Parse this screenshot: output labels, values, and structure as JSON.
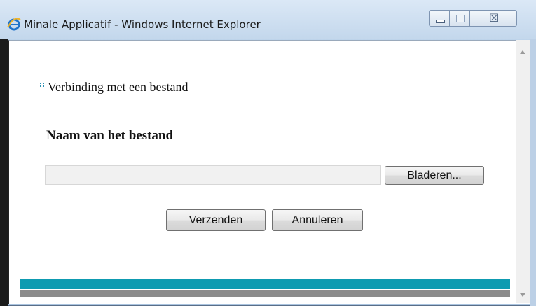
{
  "window": {
    "title": "Minale Applicatif - Windows Internet Explorer",
    "icon": "ie-icon",
    "controls": {
      "minimize": "minimize-icon",
      "maximize": "maximize-icon",
      "close": "close-icon",
      "close_glyph": "☒"
    }
  },
  "form": {
    "section_heading": "Verbinding met een bestand",
    "field_label": "Naam van het bestand",
    "file_input_value": "",
    "browse_label": "Bladeren...",
    "submit_label": "Verzenden",
    "cancel_label": "Annuleren"
  },
  "colors": {
    "accent_bar": "#0e9bb1",
    "footer_bar": "#8c8c8c",
    "bullet": "#2a8fb3"
  }
}
